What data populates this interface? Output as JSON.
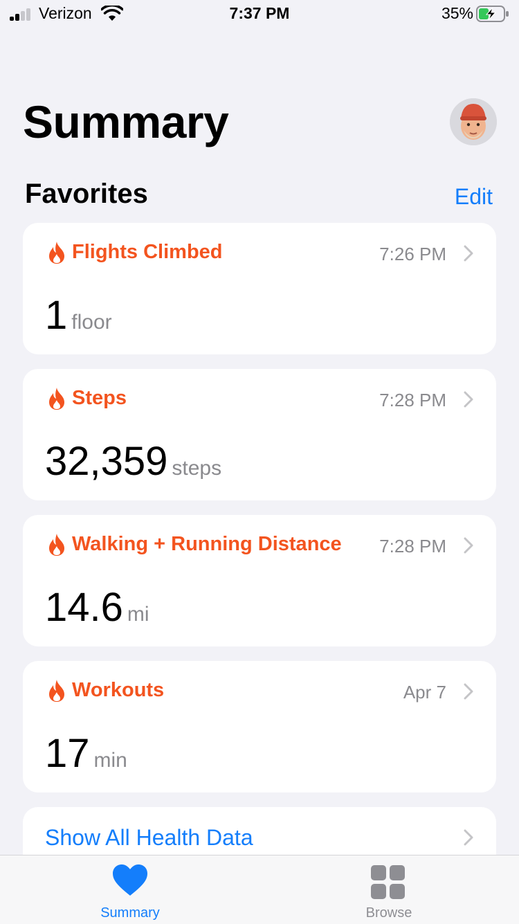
{
  "status_bar": {
    "carrier": "Verizon",
    "time": "7:37 PM",
    "battery_percent": "35%"
  },
  "header": {
    "title": "Summary"
  },
  "favorites": {
    "section_title": "Favorites",
    "edit_label": "Edit",
    "cards": [
      {
        "title": "Flights Climbed",
        "time": "7:26 PM",
        "value": "1",
        "unit": "floor"
      },
      {
        "title": "Steps",
        "time": "7:28 PM",
        "value": "32,359",
        "unit": "steps"
      },
      {
        "title": "Walking + Running Distance",
        "time": "7:28 PM",
        "value": "14.6",
        "unit": "mi"
      },
      {
        "title": "Workouts",
        "time": "Apr 7",
        "value": "17",
        "unit": "min"
      }
    ],
    "show_all_label": "Show All Health Data"
  },
  "tab_bar": {
    "tabs": [
      {
        "label": "Summary",
        "icon": "heart-icon",
        "active": true
      },
      {
        "label": "Browse",
        "icon": "grid-icon",
        "active": false
      }
    ]
  },
  "colors": {
    "accent": "#147efb",
    "activity": "#f3541f",
    "secondary_text": "#8a8a8e"
  }
}
